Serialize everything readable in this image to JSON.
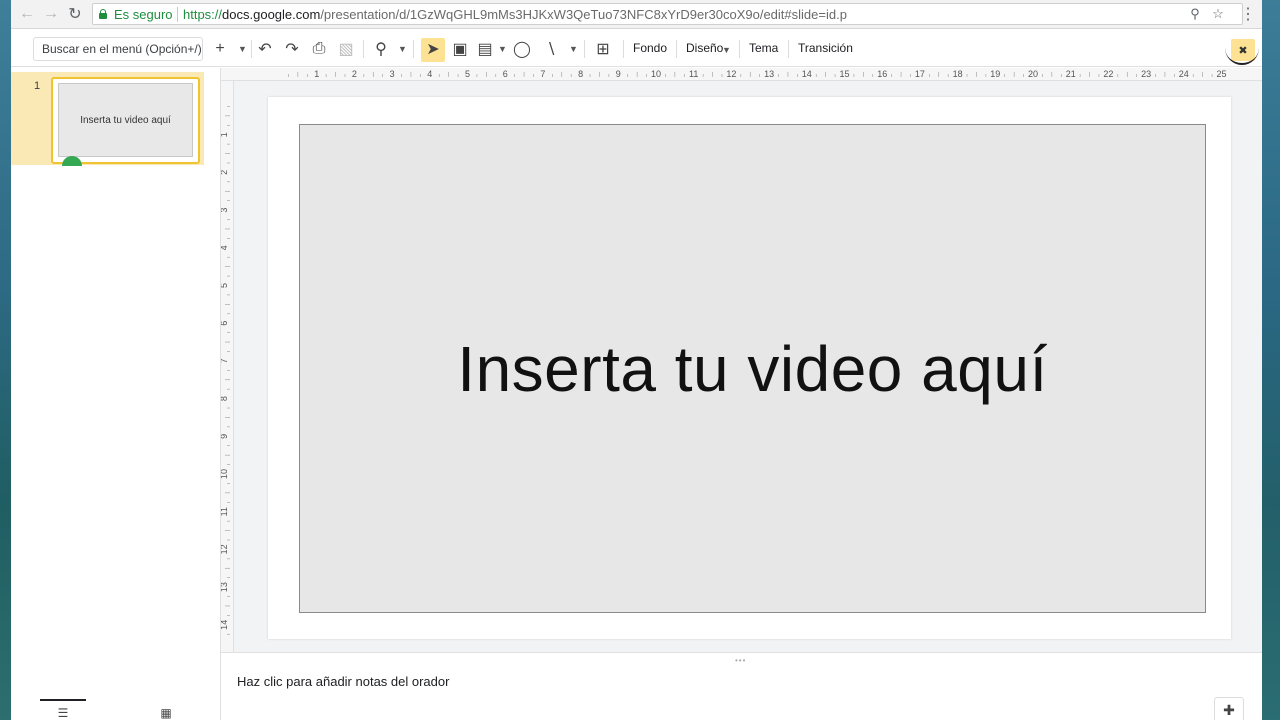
{
  "browser": {
    "secure_label": "Es seguro",
    "url_scheme": "https://",
    "url_host": "docs.google.com",
    "url_path": "/presentation/d/1GzWqGHL9mMs3HJKxW3QeTuo73NFC8xYrD9er30coX9o/edit#slide=id.p",
    "icons": {
      "back": "back-arrow-icon",
      "forward": "forward-arrow-icon",
      "reload": "reload-icon",
      "zoom": "magnifier-icon",
      "bookmark": "star-icon",
      "menu": "vertical-dots-icon"
    }
  },
  "toolbar": {
    "menu_search": "Buscar en el menú (Opción+/)",
    "fondo": "Fondo",
    "diseno": "Diseño",
    "tema": "Tema",
    "transicion": "Transición",
    "accent_color": "#fde293"
  },
  "filmstrip": {
    "slides": [
      {
        "number": "1",
        "thumb_text": "Inserta tu video aquí"
      }
    ]
  },
  "ruler": {
    "top": [
      "1",
      "2",
      "3",
      "4",
      "5",
      "6",
      "7",
      "8",
      "9",
      "10",
      "11",
      "12",
      "13",
      "14",
      "15",
      "16",
      "17",
      "18",
      "19",
      "20",
      "21",
      "22",
      "23",
      "24",
      "25"
    ],
    "left": [
      "1",
      "2",
      "3",
      "4",
      "5",
      "6",
      "7",
      "8",
      "9",
      "10",
      "11",
      "12",
      "13",
      "14"
    ]
  },
  "slide": {
    "placeholder_text": "Inserta tu video aquí"
  },
  "notes": {
    "placeholder": "Haz clic para añadir notas del orador"
  }
}
